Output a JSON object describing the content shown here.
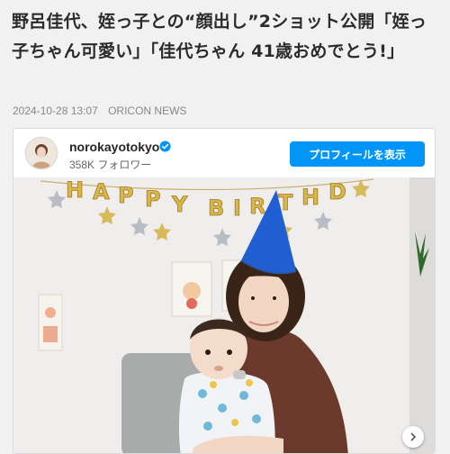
{
  "article": {
    "headline": "野呂佳代、姪っ子との“顔出し”2ショット公開「姪っ子ちゃん可愛い」「佳代ちゃん 41歳おめでとう!」",
    "date": "2024-10-28 13:07",
    "source": "ORICON NEWS"
  },
  "embed": {
    "username": "norokayotokyo",
    "followers": "358K フォロワー",
    "profile_button": "プロフィールを表示",
    "banner_text": "HAPPY BIRTHDAY"
  },
  "icons": {
    "verified": "verified-badge-icon",
    "next": "chevron-right-icon"
  },
  "colors": {
    "accent": "#0095f6",
    "party_hat": "#1f5fd1"
  }
}
